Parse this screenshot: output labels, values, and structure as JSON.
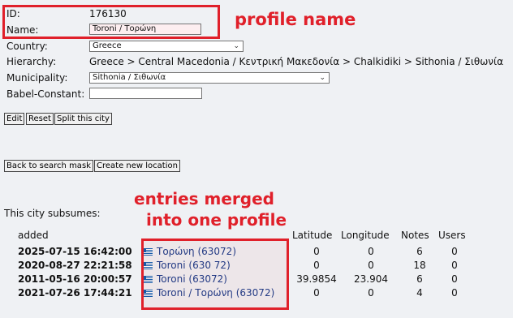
{
  "form": {
    "id_label": "ID:",
    "id_value": "176130",
    "name_label": "Name:",
    "name_value": "Toroni / Τορώνη",
    "country_label": "Country:",
    "country_value": "Greece",
    "hierarchy_label": "Hierarchy:",
    "hierarchy_value": "Greece > Central Macedonia / Κεντρική Μακεδονία > Chalkidiki > Sithonia / Σιθωνία",
    "municipality_label": "Municipality:",
    "municipality_value": "Sithonia / Σιθωνία",
    "babel_label": "Babel-Constant:",
    "babel_value": ""
  },
  "buttons": {
    "edit": "Edit",
    "reset": "Reset",
    "split": "Split this city",
    "back": "Back to search mask",
    "create": "Create new location"
  },
  "subsumes_label": "This city subsumes:",
  "table": {
    "headers": [
      "added",
      "",
      "Latitude",
      "Longitude",
      "Notes",
      "Users"
    ],
    "rows": [
      {
        "added": "2025-07-15 16:42:00",
        "name": "Τορώνη (63072)",
        "lat": "0",
        "lon": "0",
        "notes": "6",
        "users": "0"
      },
      {
        "added": "2020-08-27 22:21:58",
        "name": "Toroni (630 72)",
        "lat": "0",
        "lon": "0",
        "notes": "18",
        "users": "0"
      },
      {
        "added": "2011-05-16 20:00:57",
        "name": "Toroni (63072)",
        "lat": "39.9854",
        "lon": "23.904",
        "notes": "6",
        "users": "0"
      },
      {
        "added": "2021-07-26 17:44:21",
        "name": "Toroni / Τορώνη (63072)",
        "lat": "0",
        "lon": "0",
        "notes": "4",
        "users": "0"
      }
    ]
  },
  "annotations": {
    "profile_name": "profile name",
    "merged_line1": "entries merged",
    "merged_line2": "into one profile"
  },
  "colors": {
    "annotation": "#e0202a",
    "background": "#eff1f4"
  },
  "icons": {
    "flag": "greece-flag-icon",
    "dropdown": "chevron-down-icon"
  }
}
